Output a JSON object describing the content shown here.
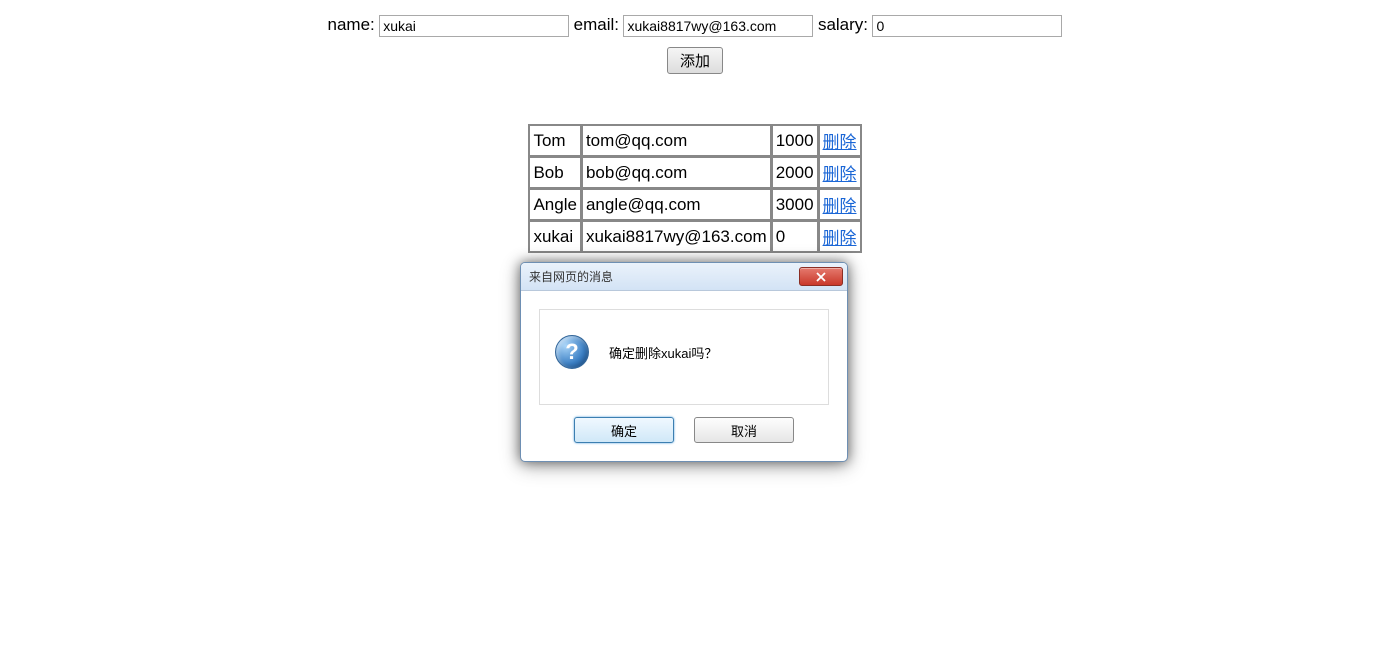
{
  "form": {
    "name_label": "name:",
    "name_value": "xukai",
    "email_label": "email:",
    "email_value": "xukai8817wy@163.com",
    "salary_label": "salary:",
    "salary_value": "0",
    "add_button": "添加"
  },
  "table": {
    "rows": [
      {
        "name": "Tom",
        "email": "tom@qq.com",
        "salary": "1000",
        "action": "删除"
      },
      {
        "name": "Bob",
        "email": "bob@qq.com",
        "salary": "2000",
        "action": "删除"
      },
      {
        "name": "Angle",
        "email": "angle@qq.com",
        "salary": "3000",
        "action": "删除"
      },
      {
        "name": "xukai",
        "email": "xukai8817wy@163.com",
        "salary": "0",
        "action": "删除"
      }
    ]
  },
  "dialog": {
    "title": "来自网页的消息",
    "message": "确定删除xukai吗？",
    "ok": "确定",
    "cancel": "取消"
  }
}
